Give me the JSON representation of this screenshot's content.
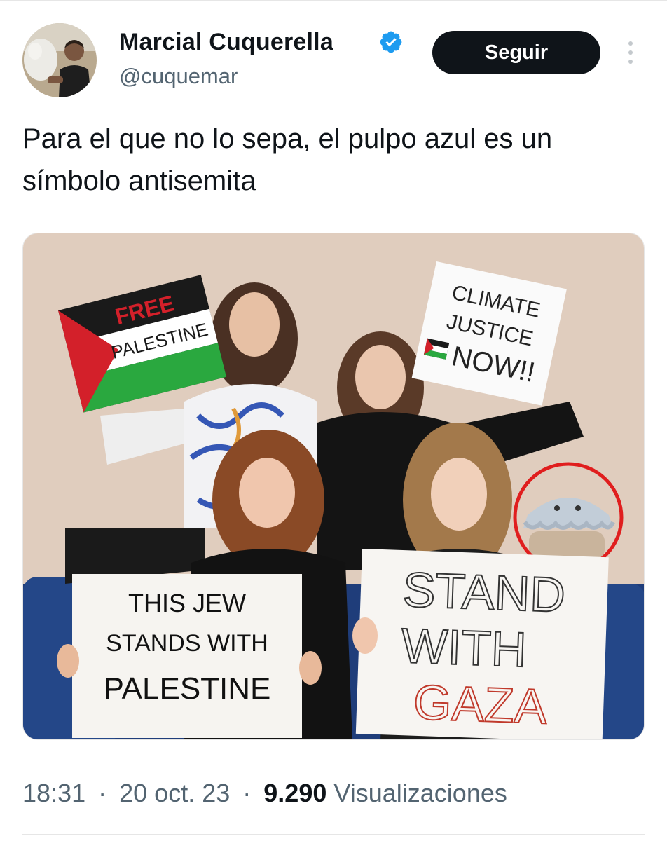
{
  "author": {
    "display_name": "Marcial Cuquerella",
    "handle": "@cuquemar",
    "verified_icon": "verified-badge-icon",
    "avatar_icon": "profile-photo"
  },
  "actions": {
    "follow_label": "Seguir",
    "more_icon": "more-vertical-icon"
  },
  "tweet": {
    "text": "Para el que no lo sepa, el pulpo azul es un símbolo antisemita"
  },
  "photo": {
    "sign_free": "FREE",
    "sign_palestine": "PALESTINE",
    "sign_climate_1": "CLIMATE",
    "sign_climate_2": "JUSTICE",
    "sign_climate_3": "NOW!!",
    "sign_jew_1": "THIS JEW",
    "sign_jew_2": "STANDS WITH",
    "sign_jew_3": "PALESTINE",
    "sign_gaza_1": "STAND",
    "sign_gaza_2": "WITH",
    "sign_gaza_3": "GAZA",
    "highlight_color": "#e01e1e",
    "highlight_subject": "octopus-plush-icon"
  },
  "meta": {
    "time": "18:31",
    "separator": "·",
    "date": "20 oct. 23",
    "views_count": "9.290",
    "views_label": "Visualizaciones"
  },
  "colors": {
    "text_primary": "#0f1419",
    "text_secondary": "#536471",
    "button_bg": "#0f1419",
    "verified_blue": "#1d9bf0"
  }
}
